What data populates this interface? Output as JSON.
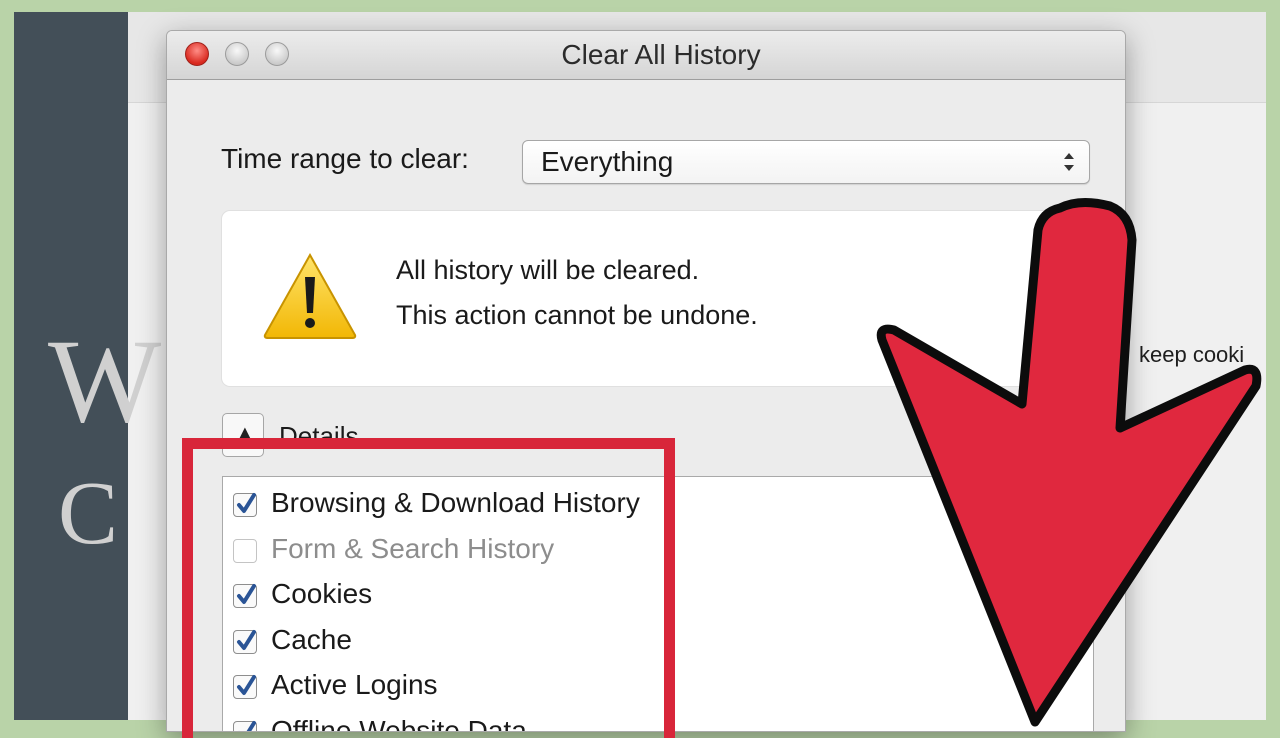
{
  "dialog": {
    "title": "Clear All History",
    "time_range_label": "Time range to clear:",
    "time_range_value": "Everything",
    "warning_line1": "All history will be cleared.",
    "warning_line2": "This action cannot be undone.",
    "details_label": "Details",
    "items": [
      {
        "label": "Browsing & Download History",
        "checked": true,
        "enabled": true
      },
      {
        "label": "Form & Search History",
        "checked": false,
        "enabled": false
      },
      {
        "label": "Cookies",
        "checked": true,
        "enabled": true
      },
      {
        "label": "Cache",
        "checked": true,
        "enabled": true
      },
      {
        "label": "Active Logins",
        "checked": true,
        "enabled": true
      },
      {
        "label": "Offline Website Data",
        "checked": true,
        "enabled": true
      }
    ]
  },
  "background": {
    "partial_text": "keep cooki"
  },
  "icons": {
    "warning": "warning-triangle-icon",
    "select_arrows": "updown-chevron-icon",
    "details_toggle": "chevron-up-icon",
    "checkbox": "checkmark-icon"
  },
  "colors": {
    "highlight": "#d8263a",
    "arrow": "#e0283e",
    "checkbox_check": "#2a5496",
    "side_panel": "#434f58",
    "outer_background": "#b9d3a8"
  }
}
